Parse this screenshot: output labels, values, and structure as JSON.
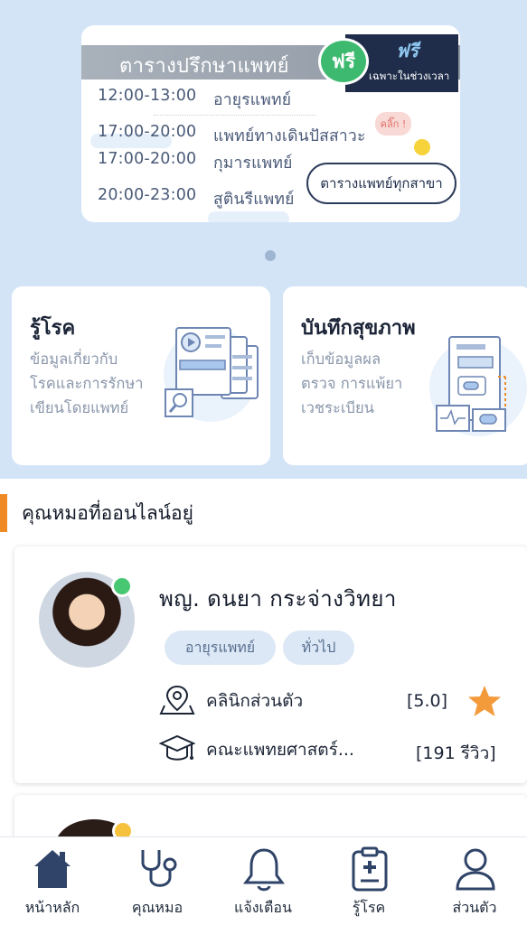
{
  "banner": {
    "title": "ตารางปรึกษาแพทย์",
    "free_badge": "ฟรี",
    "free_label": "ฟรี",
    "free_note": "เฉพาะในช่วงเวลา",
    "schedule": [
      {
        "time": "12:00-13:00",
        "specialty": "อายุรแพทย์"
      },
      {
        "time": "17:00-20:00",
        "specialty": "แพทย์ทางเดินปัสสาวะ"
      },
      {
        "time": "17:00-20:00",
        "specialty": "กุมารแพทย์"
      },
      {
        "time": "20:00-23:00",
        "specialty": "สูตินรีแพทย์"
      }
    ],
    "click_bubble": "คลิ๊ก !",
    "all_schedule_button": "ตารางแพทย์ทุกสาขา"
  },
  "features": [
    {
      "title": "รู้โรค",
      "lines": [
        "ข้อมูลเกี่ยวกับ",
        "โรคและการรักษา",
        "เขียนโดยแพทย์"
      ]
    },
    {
      "title": "บันทึกสุขภาพ",
      "lines": [
        "เก็บข้อมูลผล",
        "ตรวจ การแพ้ยา",
        "เวชระเบียน"
      ]
    }
  ],
  "online_section": {
    "title": "คุณหมอที่ออนไลน์อยู่"
  },
  "doctor": {
    "name": "พญ. ดนยา กระจ่างวิทยา",
    "tags": [
      "อายุรแพทย์",
      "ทั่วไป"
    ],
    "clinic": "คลินิกส่วนตัว",
    "rating": "[5.0]",
    "education": "คณะแพทยศาสตร์...",
    "reviews": "[191 รีวิว]",
    "status_color": "#48c773"
  },
  "nav": [
    {
      "label": "หน้าหลัก",
      "icon": "home-icon",
      "active": true
    },
    {
      "label": "คุณหมอ",
      "icon": "stethoscope-icon",
      "active": false
    },
    {
      "label": "แจ้งเตือน",
      "icon": "bell-icon",
      "active": false
    },
    {
      "label": "รู้โรค",
      "icon": "medical-clipboard-icon",
      "active": false
    },
    {
      "label": "ส่วนตัว",
      "icon": "user-icon",
      "active": false
    }
  ],
  "colors": {
    "accent": "#f08a24",
    "nav_dark": "#2f4468",
    "star": "#f39a3a"
  }
}
